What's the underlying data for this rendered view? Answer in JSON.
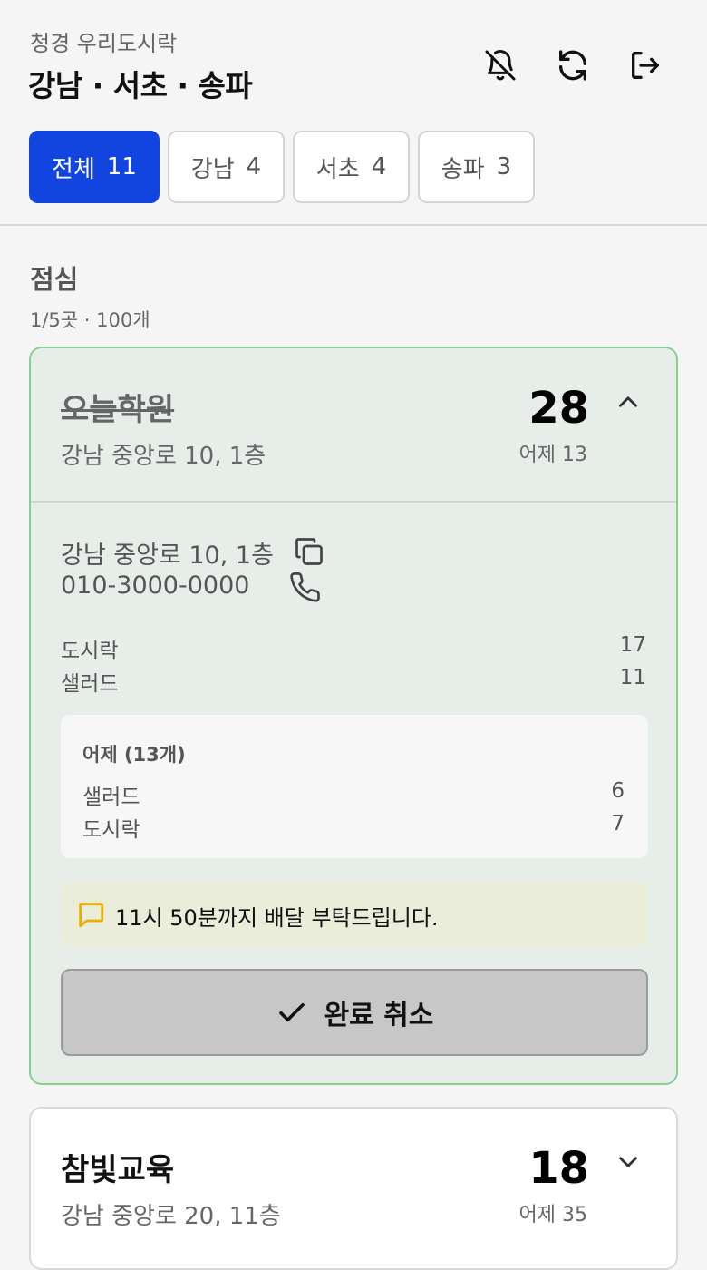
{
  "header": {
    "subtitle": "청경 우리도시락",
    "title": "강남 · 서초 · 송파"
  },
  "tabs": [
    {
      "label": "전체",
      "count": "11",
      "active": true
    },
    {
      "label": "강남",
      "count": "4",
      "active": false
    },
    {
      "label": "서초",
      "count": "4",
      "active": false
    },
    {
      "label": "송파",
      "count": "3",
      "active": false
    }
  ],
  "section": {
    "title": "점심",
    "summary": "1/5곳 · 100개"
  },
  "cards": [
    {
      "name": "오늘학원",
      "address": "강남 중앙로 10, 1층",
      "count": "28",
      "yesterday": "어제 13",
      "detail_address": "강남 중앙로 10, 1층",
      "phone": "010-3000-0000",
      "items": [
        {
          "name": "도시락",
          "qty": "17"
        },
        {
          "name": "샐러드",
          "qty": "11"
        }
      ],
      "yesterday_box": {
        "title": "어제 (13개)",
        "items": [
          {
            "name": "샐러드",
            "qty": "6"
          },
          {
            "name": "도시락",
            "qty": "7"
          }
        ]
      },
      "note": "11시 50분까지 배달 부탁드립니다.",
      "undo_label": "완료 취소"
    },
    {
      "name": "참빛교육",
      "address": "강남 중앙로 20, 11층",
      "count": "18",
      "yesterday": "어제 35"
    }
  ]
}
